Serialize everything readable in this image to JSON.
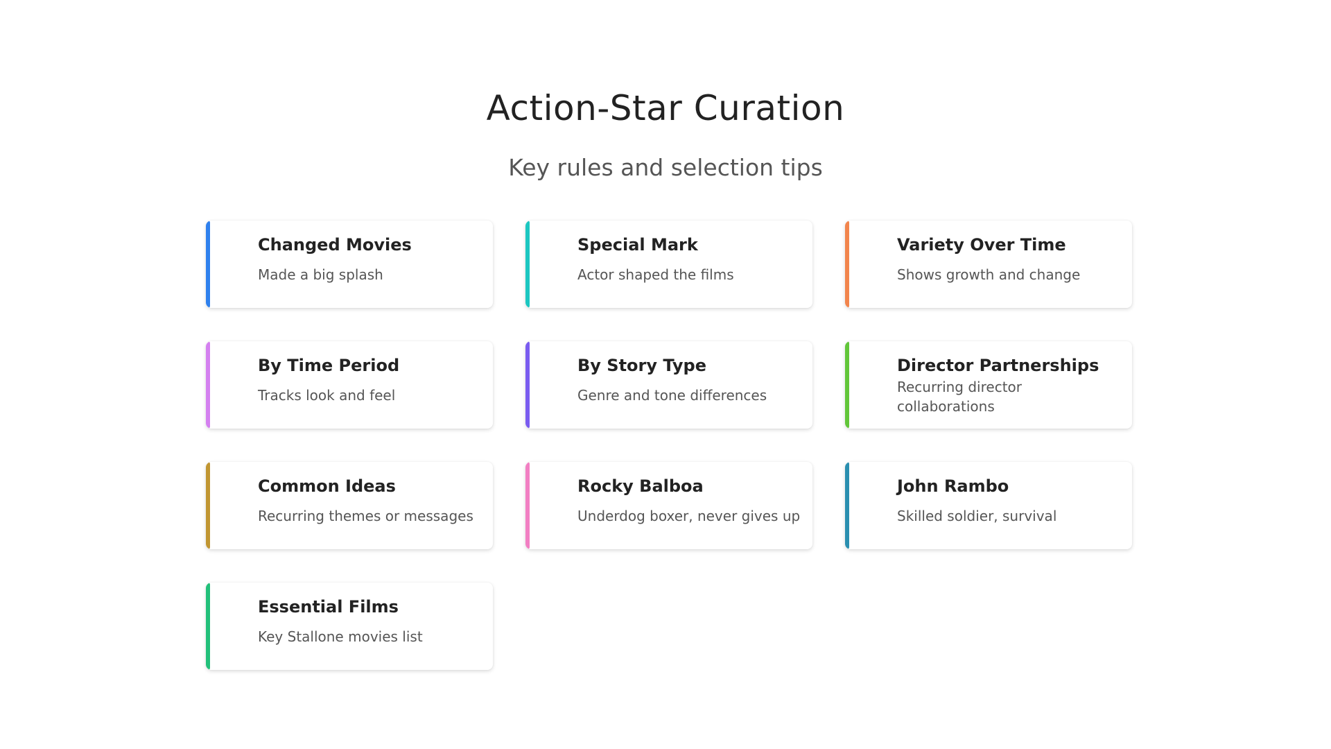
{
  "header": {
    "title": "Action-Star Curation",
    "subtitle": "Key rules and selection tips"
  },
  "cards": [
    {
      "title": "Changed Movies",
      "desc": "Made a big splash",
      "accent": "#2f80ed"
    },
    {
      "title": "Special Mark",
      "desc": "Actor shaped the films",
      "accent": "#1cc7c1"
    },
    {
      "title": "Variety Over Time",
      "desc": "Shows growth and change",
      "accent": "#f2854d"
    },
    {
      "title": "By Time Period",
      "desc": "Tracks look and feel",
      "accent": "#d480f0"
    },
    {
      "title": "By Story Type",
      "desc": "Genre and tone differences",
      "accent": "#7a5cf0"
    },
    {
      "title": "Director Partnerships",
      "desc": "Recurring director collaborations",
      "accent": "#62c63a"
    },
    {
      "title": "Common Ideas",
      "desc": "Recurring themes or messages",
      "accent": "#c19632"
    },
    {
      "title": "Rocky Balboa",
      "desc": "Underdog boxer, never gives up",
      "accent": "#f27fc3"
    },
    {
      "title": "John Rambo",
      "desc": "Skilled soldier, survival",
      "accent": "#2a8fb0"
    },
    {
      "title": "Essential Films",
      "desc": "Key Stallone movies list",
      "accent": "#22c07a"
    }
  ]
}
